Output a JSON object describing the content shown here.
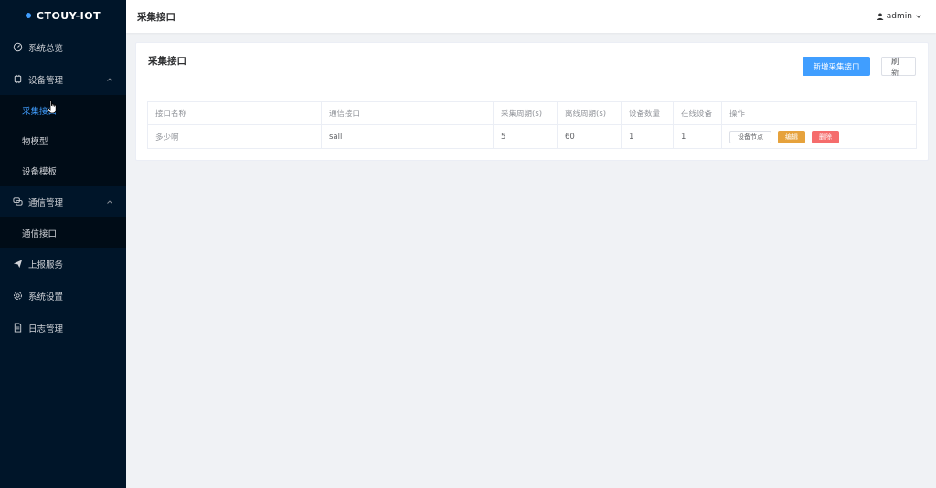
{
  "app": {
    "logo": "CTOUY-IOT"
  },
  "sidebar": {
    "items": [
      {
        "label": "系统总览",
        "icon": "dashboard-icon"
      },
      {
        "label": "设备管理",
        "icon": "chip-icon",
        "expanded": true,
        "children": [
          {
            "label": "采集接口",
            "active": true
          },
          {
            "label": "物模型"
          },
          {
            "label": "设备模板"
          }
        ]
      },
      {
        "label": "通信管理",
        "icon": "chat-icon",
        "expanded": true,
        "children": [
          {
            "label": "通信接口"
          }
        ]
      },
      {
        "label": "上报服务",
        "icon": "send-icon"
      },
      {
        "label": "系统设置",
        "icon": "gear-icon"
      },
      {
        "label": "日志管理",
        "icon": "document-icon"
      }
    ]
  },
  "header": {
    "title": "采集接口",
    "user": "admin"
  },
  "card": {
    "title": "采集接口",
    "add_button": "新增采集接口",
    "refresh_button": "刷新"
  },
  "table": {
    "columns": [
      "接口名称",
      "通信接口",
      "采集周期(s)",
      "离线周期(s)",
      "设备数量",
      "在线设备",
      "操作"
    ],
    "rows": [
      {
        "name": "多少啊",
        "comm": "sall",
        "period": "5",
        "offline": "60",
        "count": "1",
        "online": "1"
      }
    ],
    "actions": {
      "node": "设备节点",
      "edit": "编辑",
      "delete": "删除"
    }
  },
  "colors": {
    "sidebar_bg": "#001529",
    "primary": "#409eff",
    "warning": "#e6a23c",
    "danger": "#f56c6c"
  }
}
